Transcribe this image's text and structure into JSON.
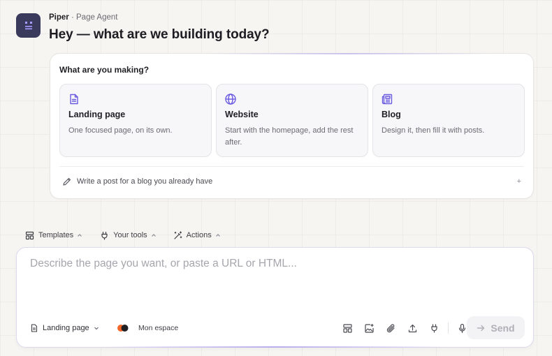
{
  "agent": {
    "name": "Piper",
    "separator": " · ",
    "role": "Page Agent",
    "greeting": "Hey — what are we building today?"
  },
  "making": {
    "title": "What are you making?",
    "options": [
      {
        "icon": "document-icon",
        "title": "Landing page",
        "desc": "One focused page, on its own."
      },
      {
        "icon": "globe-icon",
        "title": "Website",
        "desc": "Start with the homepage, add the rest after."
      },
      {
        "icon": "newspaper-icon",
        "title": "Blog",
        "desc": "Design it, then fill it with posts."
      }
    ],
    "post_label": "Write a post for a blog you already have",
    "post_action": "+"
  },
  "toolbar": {
    "templates": "Templates",
    "tools": "Your tools",
    "actions": "Actions"
  },
  "composer": {
    "placeholder": "Describe the page you want, or paste a URL or HTML...",
    "value": "",
    "page_type": "Landing page",
    "workspace": "Mon espace",
    "send": "Send"
  },
  "colors": {
    "accent": "#6a5ae0",
    "avatar_bg": "#3a3a5c",
    "brand_orange": "#f2672a"
  }
}
